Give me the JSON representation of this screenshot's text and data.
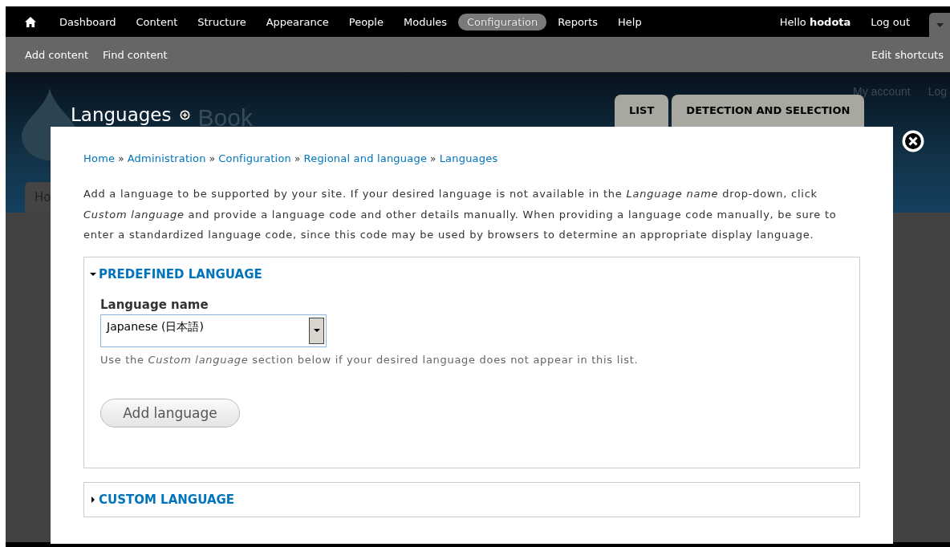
{
  "toolbar": {
    "menu": [
      {
        "label": "Dashboard",
        "selected": false
      },
      {
        "label": "Content",
        "selected": false
      },
      {
        "label": "Structure",
        "selected": false
      },
      {
        "label": "Appearance",
        "selected": false
      },
      {
        "label": "People",
        "selected": false
      },
      {
        "label": "Modules",
        "selected": false
      },
      {
        "label": "Configuration",
        "selected": true
      },
      {
        "label": "Reports",
        "selected": false
      },
      {
        "label": "Help",
        "selected": false
      }
    ],
    "greeting": "Hello **hodota**",
    "logout": "Log out"
  },
  "shortcuts": {
    "items": [
      "Add content",
      "Find content"
    ],
    "edit": "Edit shortcuts"
  },
  "header": {
    "site_name": "Book",
    "secondary_links": [
      "My account",
      "Log"
    ],
    "page_title": "Languages",
    "tabs": [
      {
        "label": "LIST",
        "selected": false
      },
      {
        "label": "DETECTION AND SELECTION",
        "selected": false
      }
    ],
    "background_tab": "Ho"
  },
  "dialog": {
    "breadcrumb": [
      "Home",
      "Administration",
      "Configuration",
      "Regional and language",
      "Languages"
    ],
    "breadcrumb_separator": "»",
    "description": "Add a language to be supported by your site. If your desired language is not available in the *Language name* drop-down, click *Custom language* and provide a language code and other details manually. When providing a language code manually, be sure to enter a standardized language code, since this code may be used by browsers to determine an appropriate display language.",
    "sections": [
      {
        "title": "PREDEFINED LANGUAGE",
        "expanded": true,
        "field_label": "Language name",
        "value": "Japanese (日本語)",
        "help": "Use the *Custom language* section below if your desired language does not appear in this list.",
        "button": "Add language"
      },
      {
        "title": "CUSTOM LANGUAGE",
        "expanded": false
      }
    ]
  }
}
